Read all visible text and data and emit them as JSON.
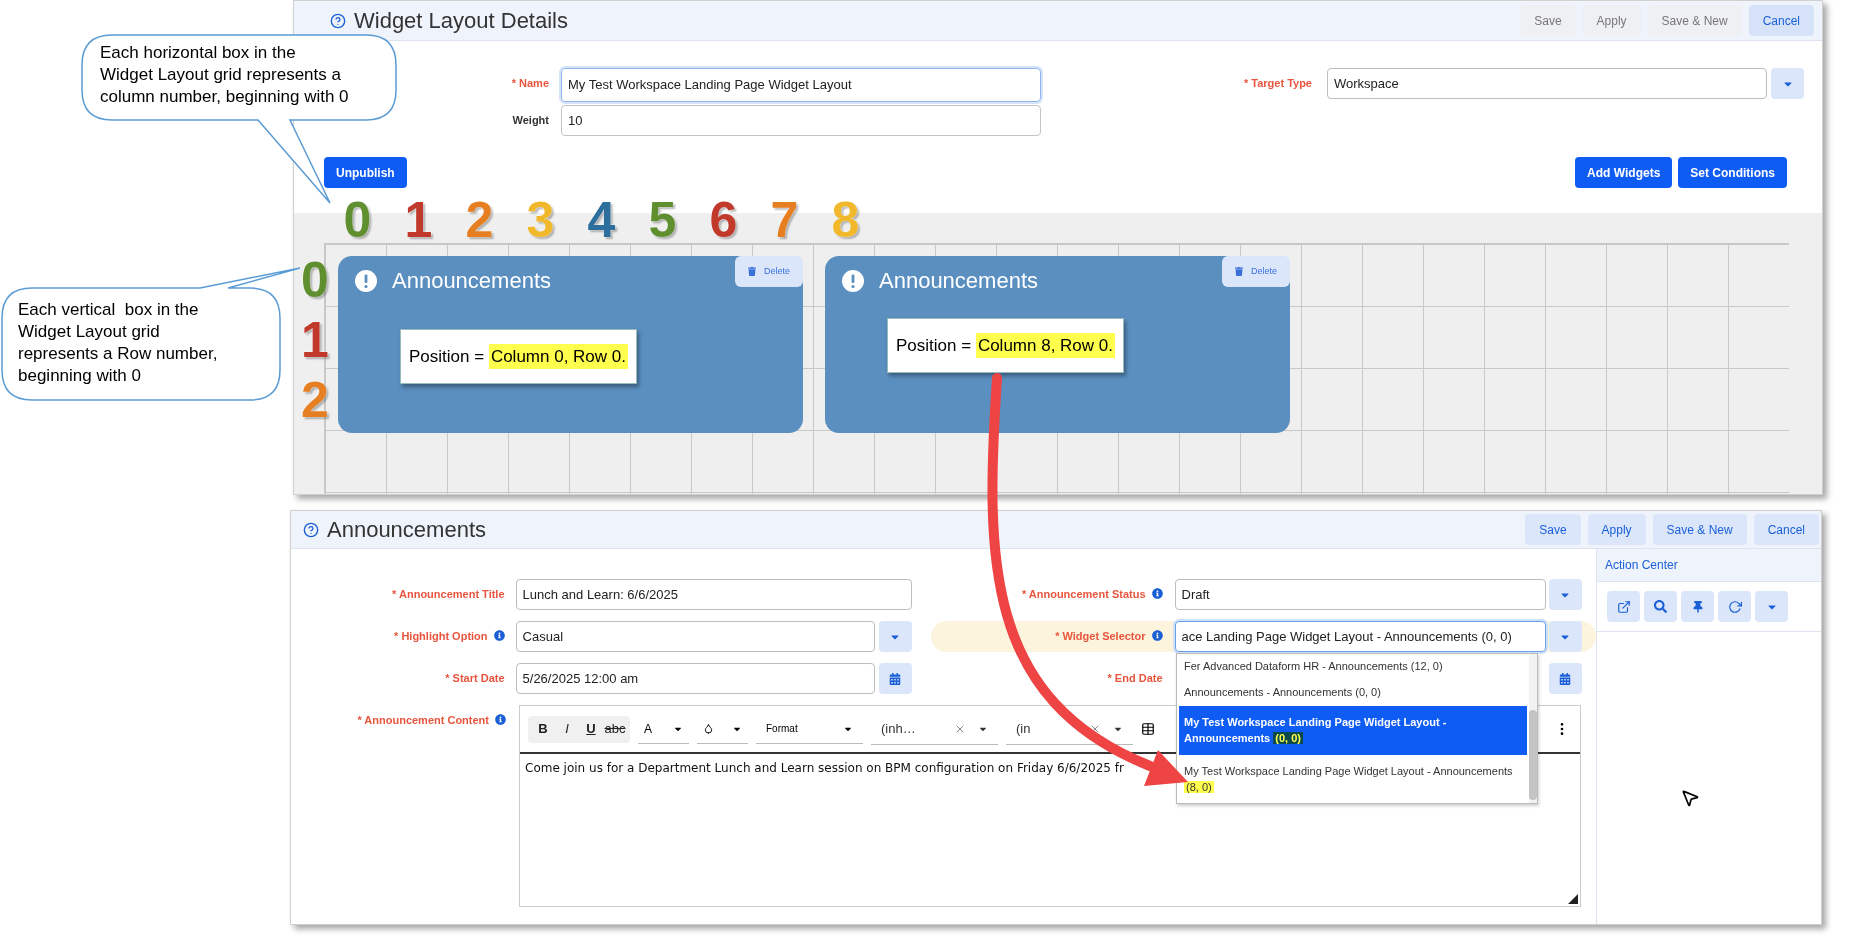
{
  "annotations": {
    "callouts": [
      {
        "lines": [
          "Each horizontal box in the",
          "Widget Layout grid represents a",
          "column number, beginning with 0"
        ]
      },
      {
        "lines": [
          "Each vertical  box in the",
          "Widget Layout grid",
          "represents a Row number,",
          "beginning with 0"
        ]
      }
    ],
    "column_numbers": [
      {
        "text": "0",
        "color": "#5f8f2f"
      },
      {
        "text": "1",
        "color": "#c0392b"
      },
      {
        "text": "2",
        "color": "#e67e22"
      },
      {
        "text": "3",
        "color": "#f0b82a"
      },
      {
        "text": "4",
        "color": "#2c6e9c"
      },
      {
        "text": "5",
        "color": "#5f8f2f"
      },
      {
        "text": "6",
        "color": "#c0392b"
      },
      {
        "text": "7",
        "color": "#e67e22"
      },
      {
        "text": "8",
        "color": "#f0b82a"
      }
    ],
    "row_numbers": [
      {
        "text": "0",
        "color": "#5f8f2f"
      },
      {
        "text": "1",
        "color": "#c0392b"
      },
      {
        "text": "2",
        "color": "#e67e22"
      }
    ]
  },
  "layout_window": {
    "title": "Widget Layout Details",
    "actions": [
      {
        "label": "Save",
        "kind": "plain"
      },
      {
        "label": "Apply",
        "kind": "plain"
      },
      {
        "label": "Save & New",
        "kind": "plain"
      },
      {
        "label": "Cancel",
        "kind": "accent"
      }
    ],
    "name": {
      "label": "* Name",
      "required": true,
      "value": "My Test Workspace Landing Page Widget Layout"
    },
    "weight": {
      "label": "Weight",
      "required": false,
      "value": "10"
    },
    "target_type": {
      "label": "* Target Type",
      "required": true,
      "value": "Workspace"
    },
    "left_buttons": [
      "Unpublish"
    ],
    "right_buttons": [
      "Add Widgets",
      "Set Conditions"
    ],
    "widgets": [
      {
        "title": "Announcements",
        "delete": "Delete",
        "position": "Position =",
        "highlight": "Column 0, Row 0."
      },
      {
        "title": "Announcements",
        "delete": "Delete",
        "position": "Position =",
        "highlight": "Column 8, Row 0."
      }
    ]
  },
  "announcement_window": {
    "title": "Announcements",
    "actions": [
      "Save",
      "Apply",
      "Save & New",
      "Cancel"
    ],
    "title_field": {
      "label": "* Announcement Title",
      "value": "Lunch and Learn: 6/6/2025"
    },
    "highlight_option": {
      "label": "* Highlight Option",
      "value": "Casual"
    },
    "start_date": {
      "label": "* Start Date",
      "value": "5/26/2025 12:00 am"
    },
    "status": {
      "label": "* Announcement Status",
      "value": "Draft"
    },
    "widget_selector": {
      "label": "* Widget Selector",
      "value": "ace Landing Page Widget Layout - Announcements (0, 0)",
      "options": [
        {
          "label": "Fer Advanced Dataform HR - Announcements (12, 0)",
          "selected": false
        },
        {
          "label": "Announcements - Announcements (0, 0)",
          "selected": false
        },
        {
          "label": "My Test Workspace Landing Page Widget Layout - Announcements",
          "highlight": "(0, 0)",
          "selected": true
        },
        {
          "label": "My Test Workspace Landing Page Widget Layout - Announcements",
          "highlight": "(8, 0)",
          "selected": false
        }
      ]
    },
    "end_date": {
      "label": "* End Date"
    },
    "content": {
      "label": "* Announcement Content",
      "style_buttons": [
        {
          "text": "B",
          "kind": "bold"
        },
        {
          "text": "I",
          "kind": "italic"
        },
        {
          "text": "U",
          "kind": "underline"
        },
        {
          "text": "abc",
          "kind": "strike"
        }
      ],
      "color_menu": "A",
      "format_menu": "Format",
      "font_menus": [
        "(inh…",
        "(in"
      ],
      "text": "Come join us for a Department Lunch and Learn session on BPM configuration on Friday 6/6/2025 fr"
    },
    "action_center": {
      "title": "Action Center"
    }
  }
}
